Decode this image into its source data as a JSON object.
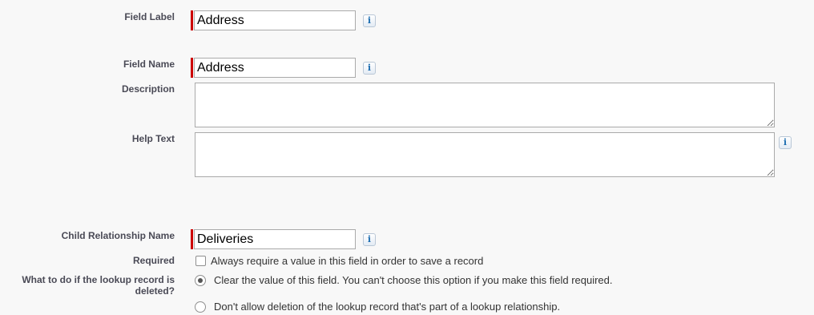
{
  "field_label": {
    "label": "Field Label",
    "value": "Address",
    "info_icon": "i"
  },
  "field_name": {
    "label": "Field Name",
    "value": "Address",
    "info_icon": "i"
  },
  "description": {
    "label": "Description",
    "value": ""
  },
  "help_text": {
    "label": "Help Text",
    "value": "",
    "info_icon": "i"
  },
  "child_relationship": {
    "label": "Child Relationship Name",
    "value": "Deliveries",
    "info_icon": "i"
  },
  "required": {
    "label": "Required",
    "checkbox_text": "Always require a value in this field in order to save a record",
    "checked": false
  },
  "lookup_deleted": {
    "label": "What to do if the lookup record is deleted?",
    "options": [
      {
        "text": "Clear the value of this field. You can't choose this option if you make this field required.",
        "selected": true
      },
      {
        "text": "Don't allow deletion of the lookup record that's part of a lookup relationship.",
        "selected": false
      }
    ]
  },
  "colors": {
    "required_bar": "#cc0000",
    "info_icon": "#1f6fb2"
  }
}
